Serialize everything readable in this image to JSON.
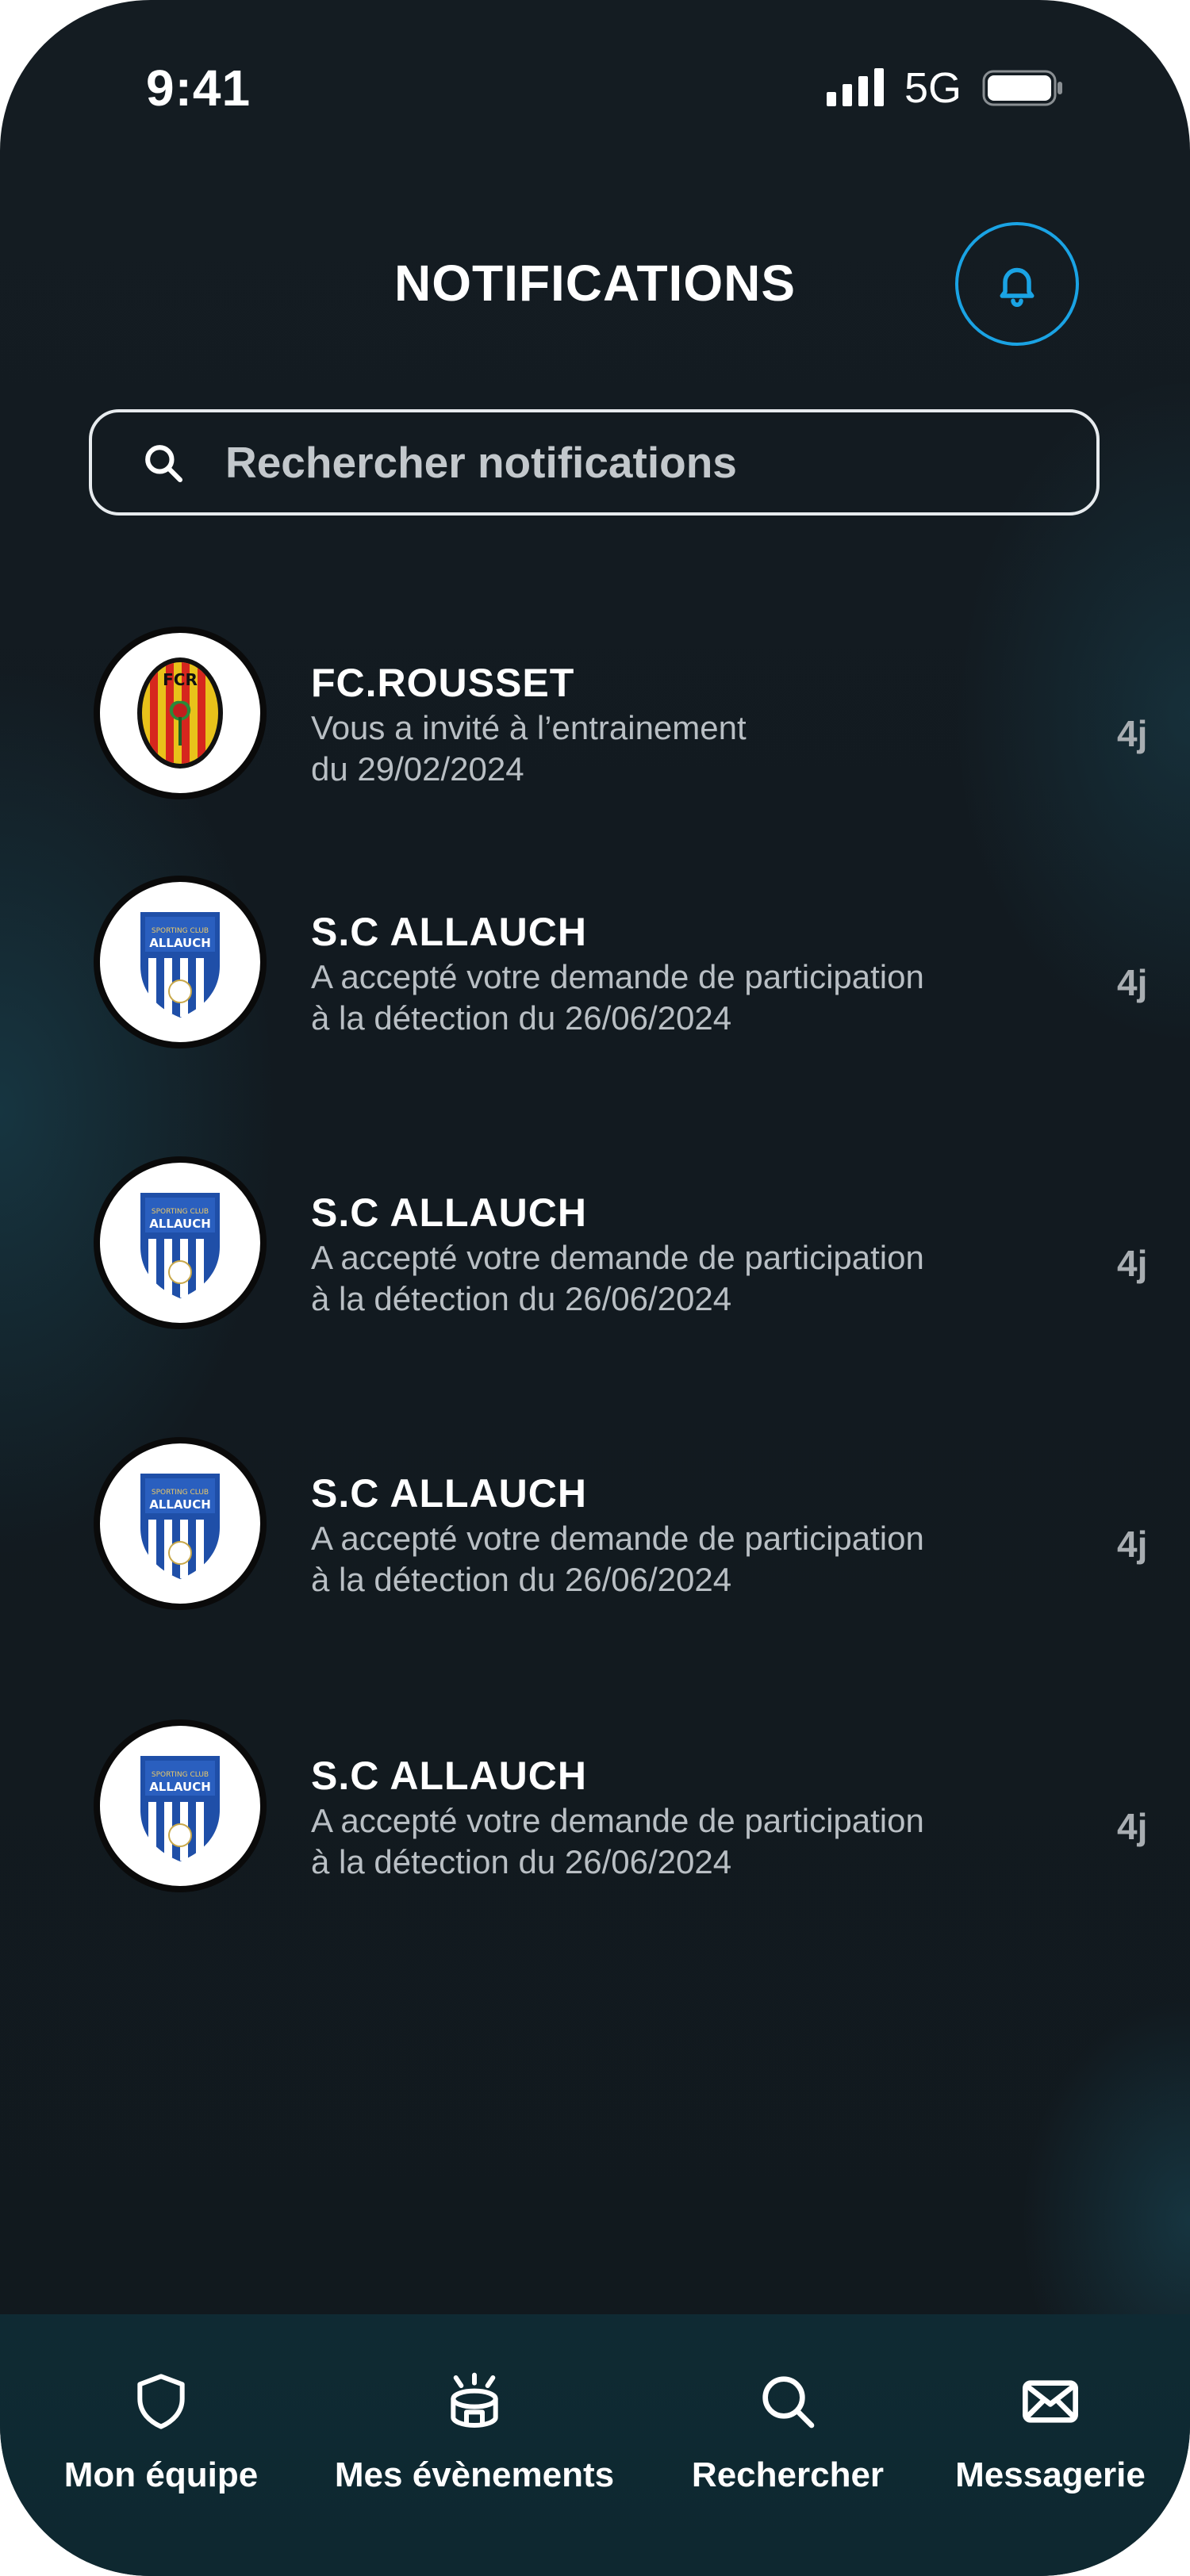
{
  "status_bar": {
    "time": "9:41",
    "network": "5G"
  },
  "header": {
    "title": "NOTIFICATIONS"
  },
  "search": {
    "placeholder": "Rechercher notifications",
    "value": ""
  },
  "notifications": [
    {
      "club": "FC.ROUSSET",
      "line1": "Vous a invité à l’entrainement",
      "line2": "du 29/02/2024",
      "age": "4j",
      "badge_text": "FCR"
    },
    {
      "club": "S.C ALLAUCH",
      "line1": "A accepté votre demande de participation",
      "line2": "à la détection du 26/06/2024",
      "age": "4j",
      "badge_text": "ALLAUCH",
      "badge_sub": "SPORTING CLUB"
    },
    {
      "club": "S.C ALLAUCH",
      "line1": "A accepté votre demande de participation",
      "line2": "à la détection du 26/06/2024",
      "age": "4j",
      "badge_text": "ALLAUCH",
      "badge_sub": "SPORTING CLUB"
    },
    {
      "club": "S.C ALLAUCH",
      "line1": "A accepté votre demande de participation",
      "line2": "à la détection du 26/06/2024",
      "age": "4j",
      "badge_text": "ALLAUCH",
      "badge_sub": "SPORTING CLUB"
    },
    {
      "club": "S.C ALLAUCH",
      "line1": "A accepté votre demande de participation",
      "line2": "à la détection du 26/06/2024",
      "age": "4j",
      "badge_text": "ALLAUCH",
      "badge_sub": "SPORTING CLUB"
    }
  ],
  "bottom_nav": [
    {
      "label": "Mon équipe",
      "icon": "shield-icon"
    },
    {
      "label": "Mes évènements",
      "icon": "stadium-icon"
    },
    {
      "label": "Rechercher",
      "icon": "search-icon"
    },
    {
      "label": "Messagerie",
      "icon": "mail-icon"
    }
  ],
  "colors": {
    "accent": "#1aa3e4",
    "background": "#121a20",
    "nav_background": "#0f2a33"
  }
}
